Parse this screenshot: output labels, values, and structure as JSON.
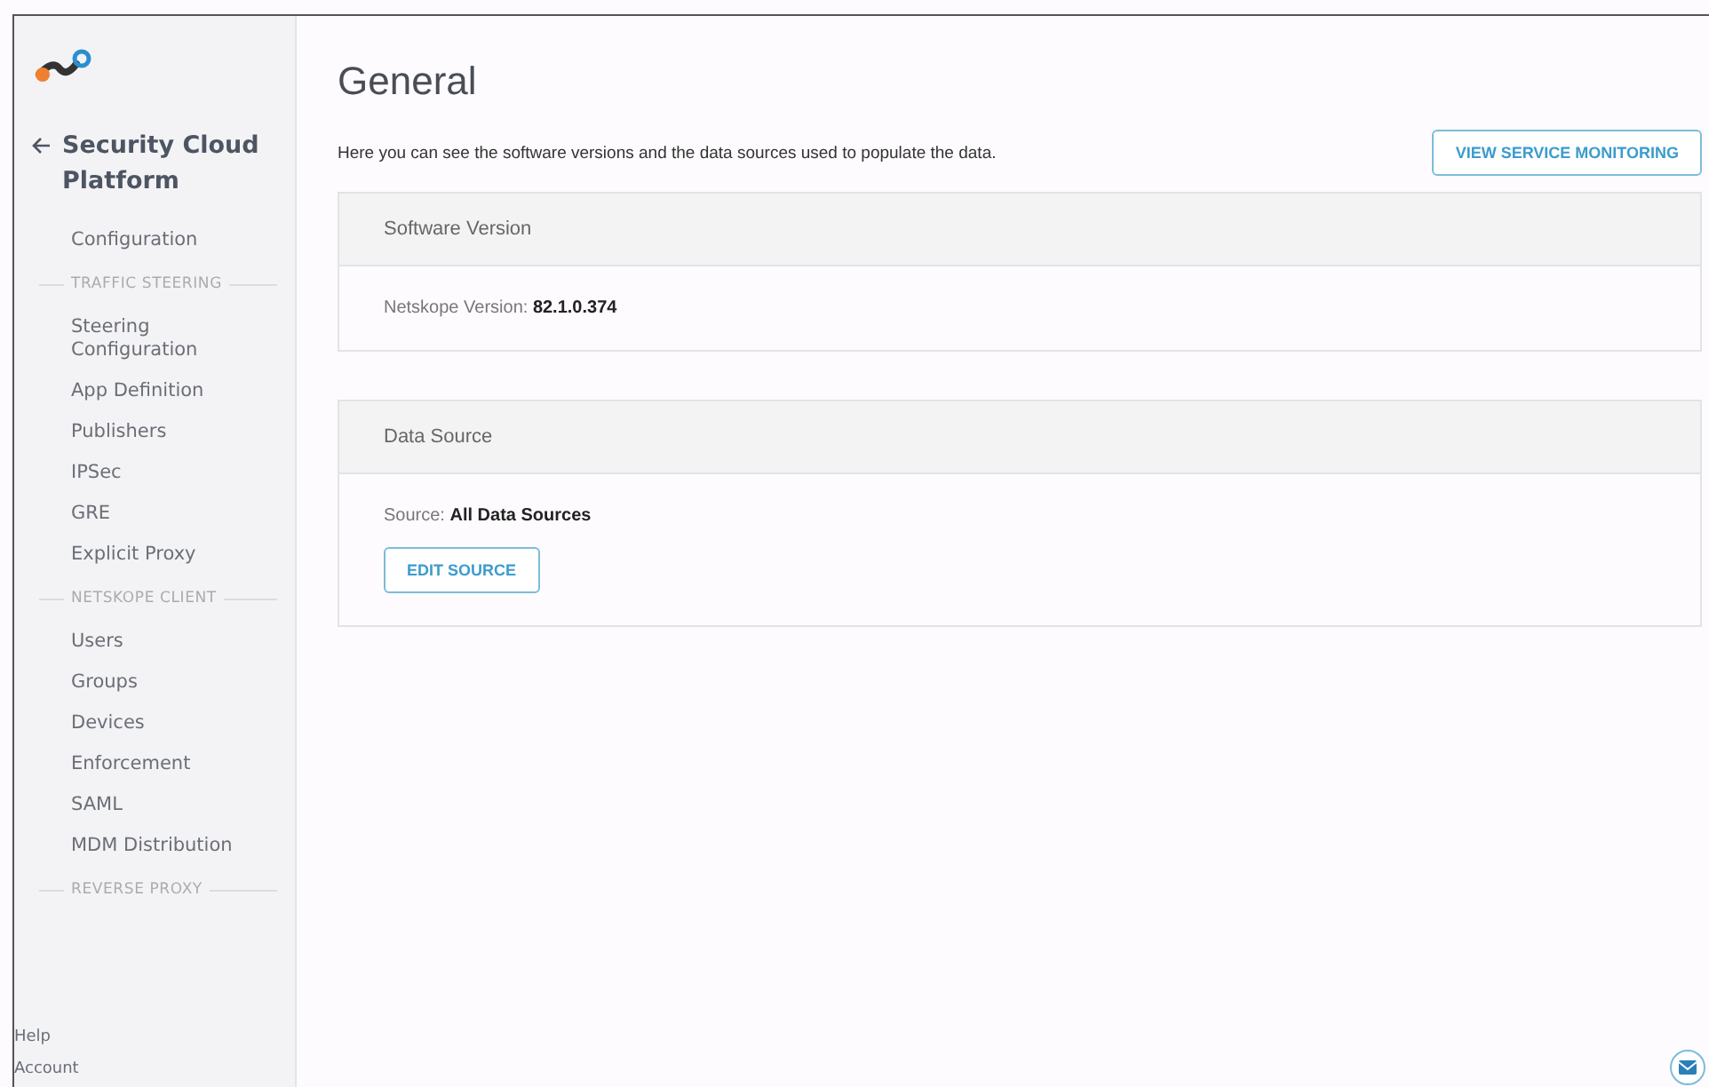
{
  "sidebar": {
    "back_title": "Security Cloud Platform",
    "items": [
      {
        "kind": "item",
        "label": "Configuration"
      },
      {
        "kind": "section",
        "label": "TRAFFIC STEERING"
      },
      {
        "kind": "item",
        "label": "Steering Configuration"
      },
      {
        "kind": "item",
        "label": "App Definition"
      },
      {
        "kind": "item",
        "label": "Publishers"
      },
      {
        "kind": "item",
        "label": "IPSec"
      },
      {
        "kind": "item",
        "label": "GRE"
      },
      {
        "kind": "item",
        "label": "Explicit Proxy"
      },
      {
        "kind": "section",
        "label": "NETSKOPE CLIENT"
      },
      {
        "kind": "item",
        "label": "Users"
      },
      {
        "kind": "item",
        "label": "Groups"
      },
      {
        "kind": "item",
        "label": "Devices"
      },
      {
        "kind": "item",
        "label": "Enforcement"
      },
      {
        "kind": "item",
        "label": "SAML"
      },
      {
        "kind": "item",
        "label": "MDM Distribution"
      },
      {
        "kind": "section",
        "label": "REVERSE PROXY"
      }
    ],
    "footer_links": [
      "Help",
      "Account"
    ]
  },
  "page": {
    "title": "General",
    "description": "Here you can see the software versions and the data sources used to populate the data.",
    "action_button": "VIEW SERVICE MONITORING",
    "cards": [
      {
        "title": "Software Version",
        "text": "Netskope Version: **82.1.0.374**"
      },
      {
        "title": "Data Source",
        "text": "Source: **All Data Sources**",
        "button": "EDIT SOURCE"
      }
    ]
  }
}
